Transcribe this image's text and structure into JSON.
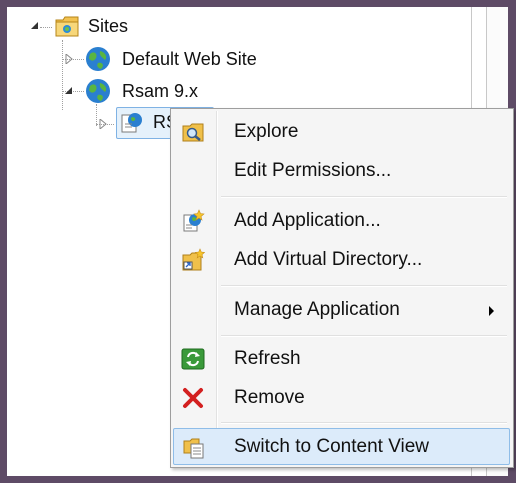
{
  "tree": {
    "sites_label": "Sites",
    "default_site_label": "Default Web Site",
    "rsam_site_label": "Rsam 9.x",
    "selected_node_label": "RS"
  },
  "context_menu": {
    "explore": "Explore",
    "edit_permissions": "Edit Permissions...",
    "add_application": "Add Application...",
    "add_virtual_directory": "Add Virtual Directory...",
    "manage_application": "Manage Application",
    "refresh": "Refresh",
    "remove": "Remove",
    "switch_to_content_view": "Switch to Content View"
  },
  "colors": {
    "frame": "#5e4b66",
    "highlight_bg": "#dcebfa",
    "highlight_border": "#8fbde8",
    "remove_red": "#d32020",
    "refresh_green": "#3a9a3a"
  },
  "icons": {
    "sites": "sites-folder-icon",
    "web_site": "globe-icon",
    "application": "application-globe-icon",
    "explore": "explore-folder-icon",
    "add_application": "add-application-icon",
    "add_virtual_directory": "add-virtual-directory-icon",
    "refresh": "refresh-icon",
    "remove": "remove-icon",
    "switch_view": "content-view-icon"
  }
}
